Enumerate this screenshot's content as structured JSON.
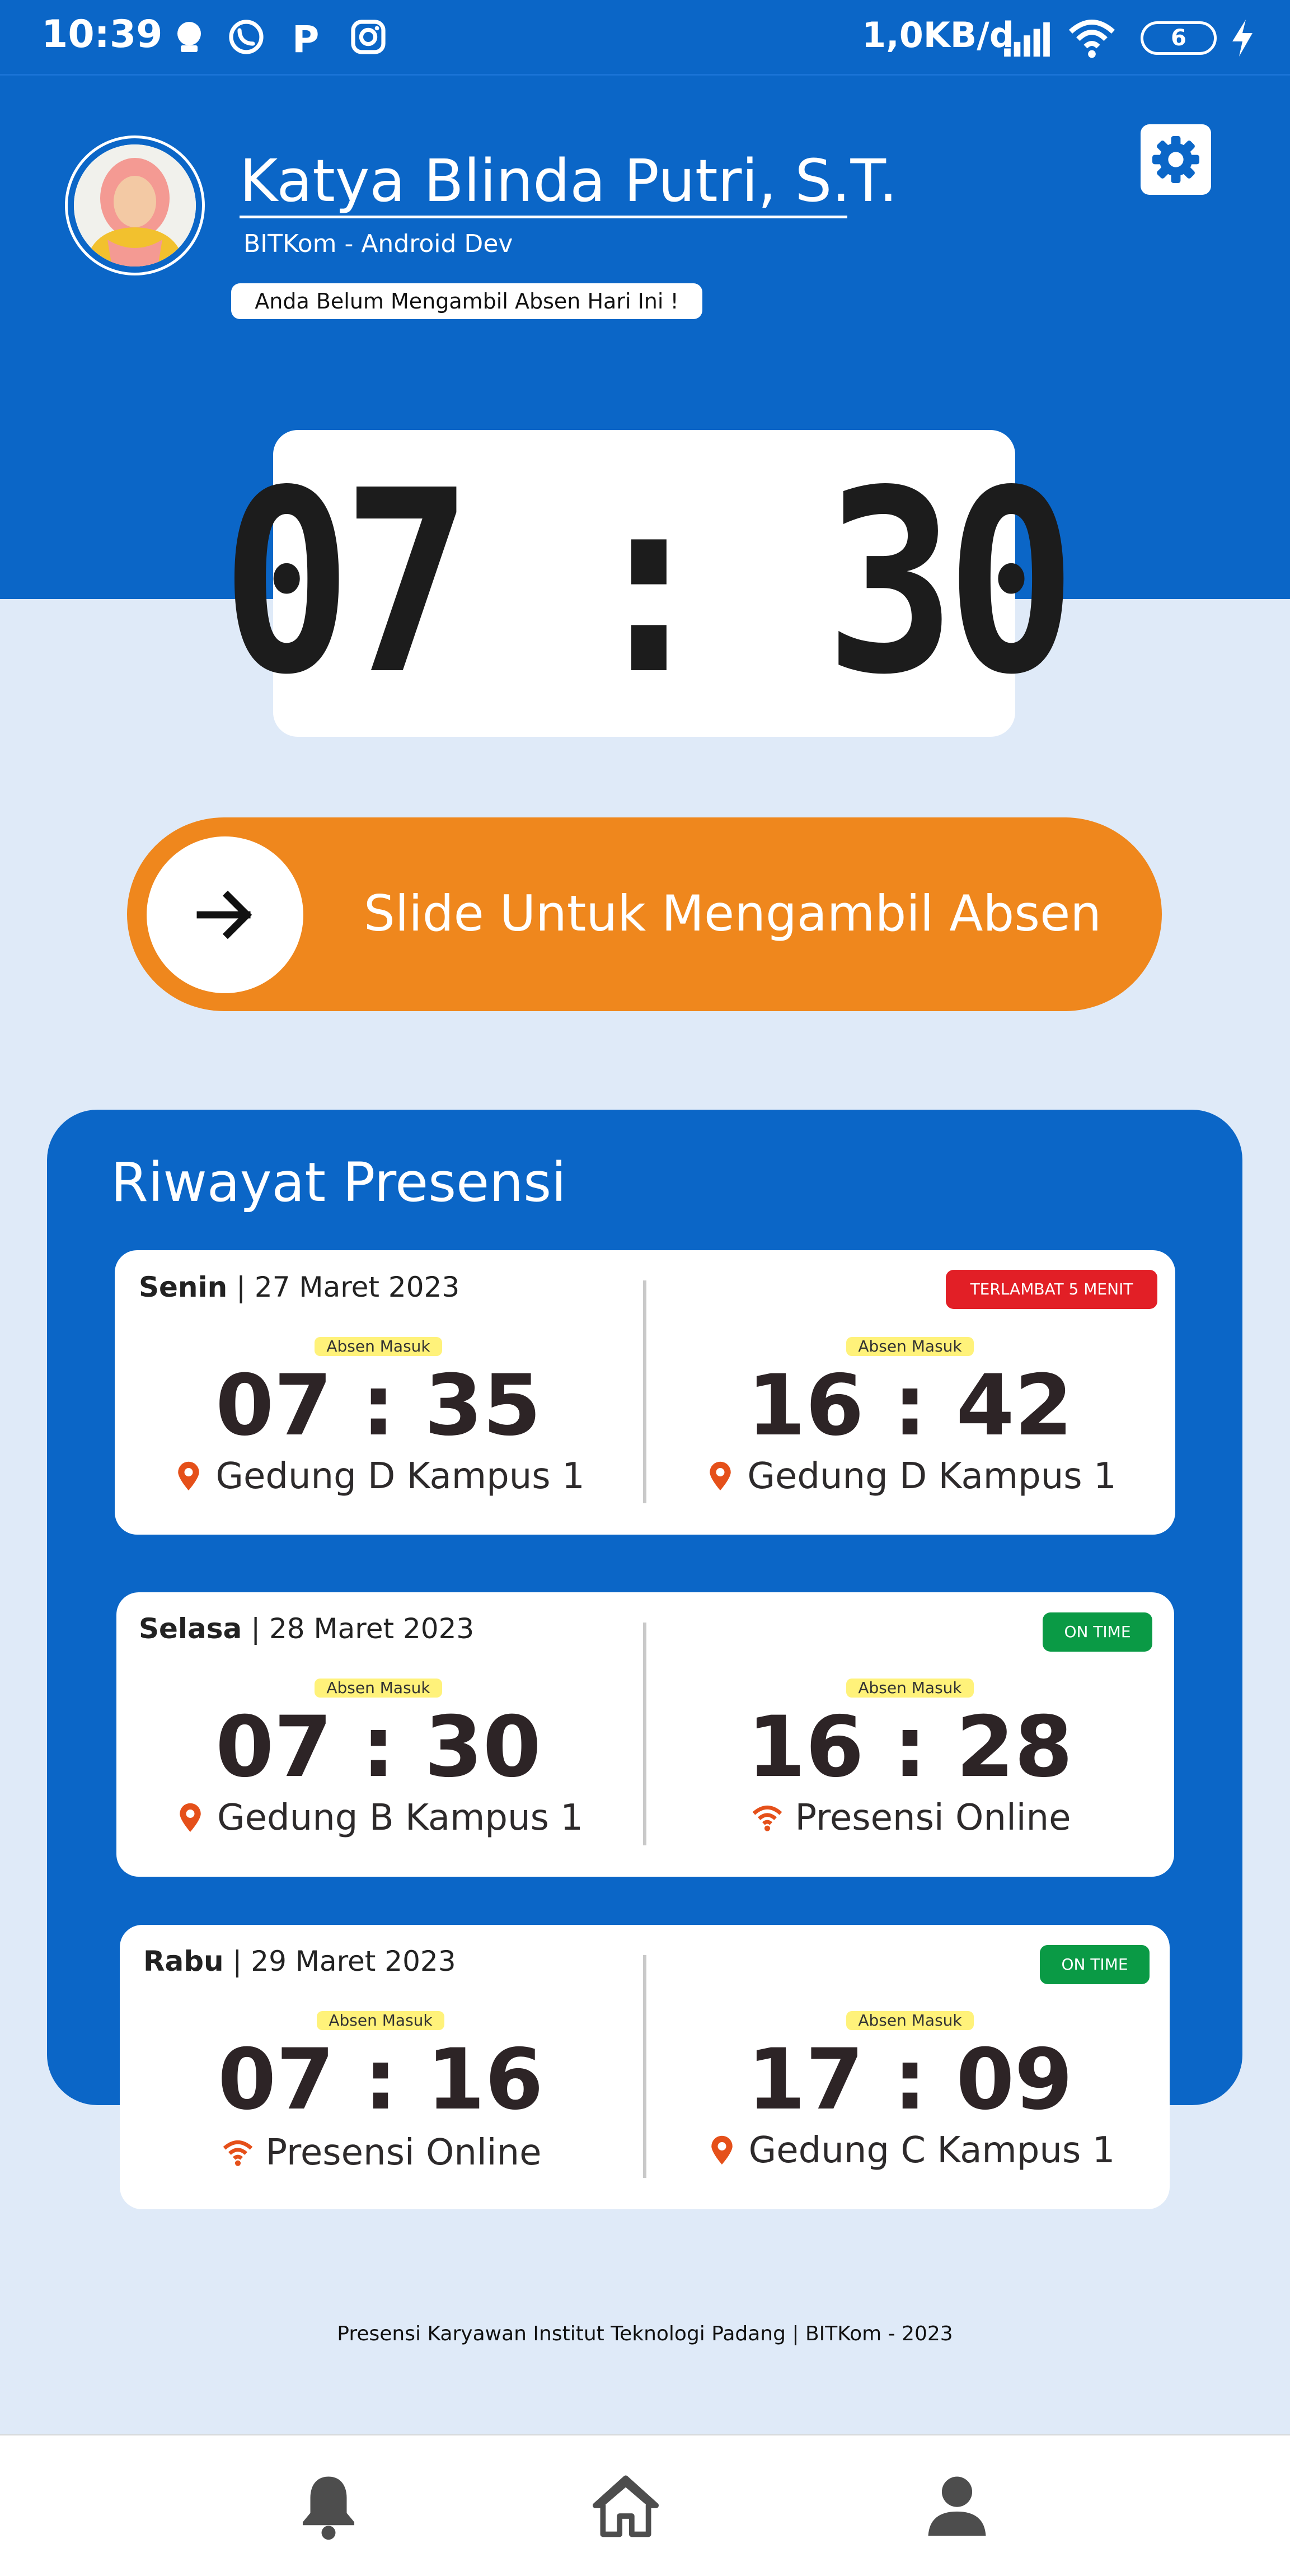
{
  "status_bar": {
    "time": "10:39",
    "speed": "1,0KB/d",
    "battery": "6",
    "icons": [
      "notification-icon",
      "whatsapp-icon",
      "p-app-icon",
      "instagram-icon",
      "signal-icon",
      "wifi-icon",
      "battery-icon",
      "charging-icon"
    ]
  },
  "profile": {
    "name": "Katya Blinda Putri, S.T.",
    "role": "BITKom - Android Dev",
    "notice": "Anda Belum Mengambil Absen Hari Ini !"
  },
  "clock": {
    "time": "07 : 30"
  },
  "slider": {
    "label": "Slide Untuk Mengambil Absen"
  },
  "history": {
    "title": "Riwayat Presensi",
    "records": [
      {
        "day": "Senin",
        "date": "| 27 Maret 2023",
        "status": "TERLAMBAT 5 MENIT",
        "status_color": "#e21f26",
        "in_label": "Absen Masuk",
        "in_time": "07 : 35",
        "in_location": "Gedung D Kampus 1",
        "in_icon": "location-pin-icon",
        "out_label": "Absen Masuk",
        "out_time": "16 : 42",
        "out_location": "Gedung D Kampus 1",
        "out_icon": "location-pin-icon"
      },
      {
        "day": "Selasa",
        "date": "| 28 Maret 2023",
        "status": "ON TIME",
        "status_color": "#0a9a45",
        "in_label": "Absen Masuk",
        "in_time": "07 : 30",
        "in_location": "Gedung B Kampus 1",
        "in_icon": "location-pin-icon",
        "out_label": "Absen Masuk",
        "out_time": "16 : 28",
        "out_location": "Presensi Online",
        "out_icon": "wifi-icon"
      },
      {
        "day": "Rabu",
        "date": "| 29 Maret 2023",
        "status": "ON TIME",
        "status_color": "#0a9a45",
        "in_label": "Absen Masuk",
        "in_time": "07 : 16",
        "in_location": "Presensi Online",
        "in_icon": "wifi-icon",
        "out_label": "Absen Masuk",
        "out_time": "17 : 09",
        "out_location": "Gedung C Kampus 1",
        "out_icon": "location-pin-icon"
      }
    ]
  },
  "footer": {
    "text": "Presensi Karyawan Institut Teknologi Padang | BITKom -  2023"
  },
  "nav": {
    "items": [
      "bell-icon",
      "home-icon",
      "profile-icon"
    ]
  },
  "colors": {
    "primary": "#0b66c7",
    "accent": "#ef871d",
    "background": "#dfeaf8",
    "pin": "#e5501a"
  }
}
